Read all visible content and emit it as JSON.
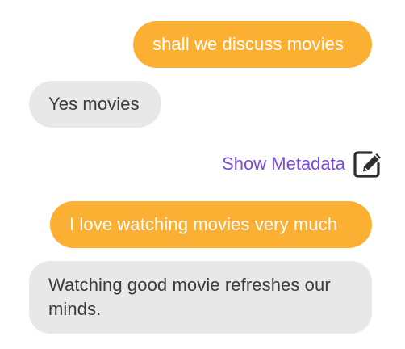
{
  "messages": [
    {
      "role": "user",
      "text": "shall we discuss movies"
    },
    {
      "role": "bot",
      "text": "Yes movies"
    },
    {
      "role": "user",
      "text": "I love watching movies very much"
    },
    {
      "role": "bot",
      "text": "Watching good movie refreshes our minds."
    }
  ],
  "metadata": {
    "link_label": "Show Metadata",
    "icon": "edit-icon"
  },
  "colors": {
    "user_bubble": "#fbb034",
    "bot_bubble": "#e8e8e8",
    "link": "#7b4bdc"
  }
}
